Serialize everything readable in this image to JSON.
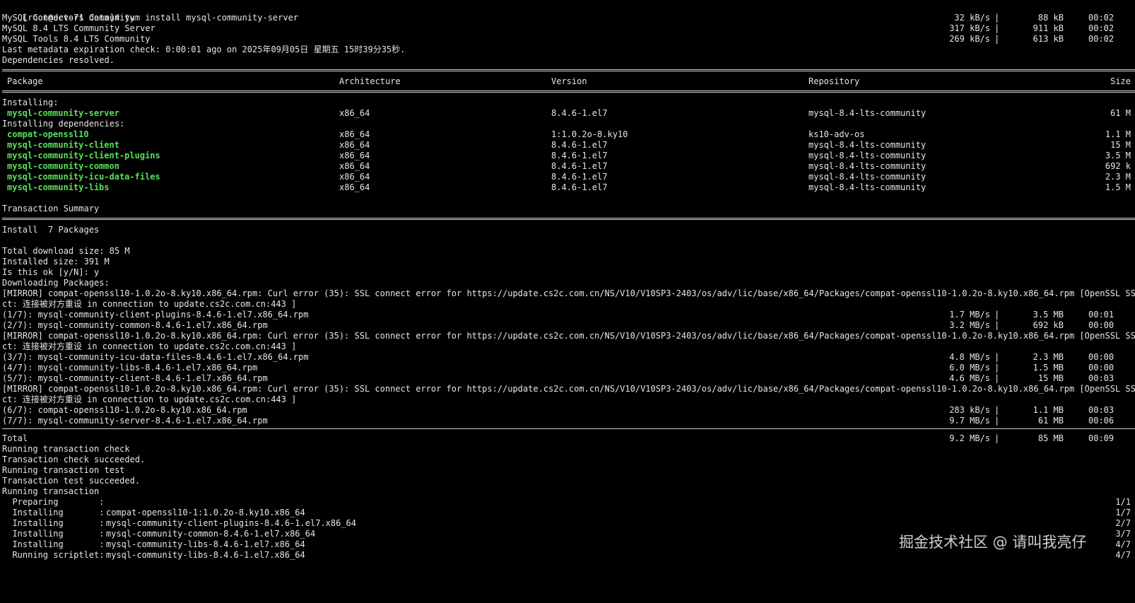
{
  "header": {
    "prompt": "[root@dev-71 data]#",
    "command": "yum install mysql-community-server"
  },
  "repos": [
    {
      "name": "MySQL Connectors Community",
      "speed": "32 kB/s",
      "size": "88 kB",
      "time": "00:02"
    },
    {
      "name": "MySQL 8.4 LTS Community Server",
      "speed": "317 kB/s",
      "size": "911 kB",
      "time": "00:02"
    },
    {
      "name": "MySQL Tools 8.4 LTS Community",
      "speed": "269 kB/s",
      "size": "613 kB",
      "time": "00:02"
    }
  ],
  "metadata_line": "Last metadata expiration check: 0:00:01 ago on 2025年09月05日 星期五 15时39分35秒.",
  "deps_resolved": "Dependencies resolved.",
  "table": {
    "headers": {
      "package": "Package",
      "arch": "Architecture",
      "version": "Version",
      "repo": "Repository",
      "size": "Size"
    },
    "installing_label": "Installing:",
    "installing": [
      {
        "package": "mysql-community-server",
        "arch": "x86_64",
        "version": "8.4.6-1.el7",
        "repo": "mysql-8.4-lts-community",
        "size": "61 M"
      }
    ],
    "deps_label": "Installing dependencies:",
    "deps": [
      {
        "package": "compat-openssl10",
        "arch": "x86_64",
        "version": "1:1.0.2o-8.ky10",
        "repo": "ks10-adv-os",
        "size": "1.1 M"
      },
      {
        "package": "mysql-community-client",
        "arch": "x86_64",
        "version": "8.4.6-1.el7",
        "repo": "mysql-8.4-lts-community",
        "size": "15 M"
      },
      {
        "package": "mysql-community-client-plugins",
        "arch": "x86_64",
        "version": "8.4.6-1.el7",
        "repo": "mysql-8.4-lts-community",
        "size": "3.5 M"
      },
      {
        "package": "mysql-community-common",
        "arch": "x86_64",
        "version": "8.4.6-1.el7",
        "repo": "mysql-8.4-lts-community",
        "size": "692 k"
      },
      {
        "package": "mysql-community-icu-data-files",
        "arch": "x86_64",
        "version": "8.4.6-1.el7",
        "repo": "mysql-8.4-lts-community",
        "size": "2.3 M"
      },
      {
        "package": "mysql-community-libs",
        "arch": "x86_64",
        "version": "8.4.6-1.el7",
        "repo": "mysql-8.4-lts-community",
        "size": "1.5 M"
      }
    ]
  },
  "summary": {
    "title": "Transaction Summary",
    "install": "Install  7 Packages",
    "total_download": "Total download size: 85 M",
    "installed_size": "Installed size: 391 M",
    "confirm": "Is this ok [y/N]: y",
    "downloading": "Downloading Packages:"
  },
  "mirror_error": {
    "part1": "[MIRROR] compat-openssl10-1.0.2o-8.ky10.x86_64.rpm: Curl error (35): SSL connect error for https://update.cs2c.com.cn/NS/V10/V10SP3-2403/os/adv/lic/base/x86_64/Packages/compat-openssl10-1.0.2o-8.ky10.x86_64.rpm [OpenSSL SSL_conne",
    "part2": "ct: 连接被对方重设 in connection to update.cs2c.com.cn:443 ]"
  },
  "downloads": [
    {
      "name": "(1/7): mysql-community-client-plugins-8.4.6-1.el7.x86_64.rpm",
      "speed": "1.7 MB/s",
      "size": "3.5 MB",
      "time": "00:01"
    },
    {
      "name": "(2/7): mysql-community-common-8.4.6-1.el7.x86_64.rpm",
      "speed": "3.2 MB/s",
      "size": "692 kB",
      "time": "00:00"
    },
    {
      "name": "(3/7): mysql-community-icu-data-files-8.4.6-1.el7.x86_64.rpm",
      "speed": "4.8 MB/s",
      "size": "2.3 MB",
      "time": "00:00"
    },
    {
      "name": "(4/7): mysql-community-libs-8.4.6-1.el7.x86_64.rpm",
      "speed": "6.0 MB/s",
      "size": "1.5 MB",
      "time": "00:00"
    },
    {
      "name": "(5/7): mysql-community-client-8.4.6-1.el7.x86_64.rpm",
      "speed": "4.6 MB/s",
      "size": "15 MB",
      "time": "00:03"
    },
    {
      "name": "(6/7): compat-openssl10-1.0.2o-8.ky10.x86_64.rpm",
      "speed": "283 kB/s",
      "size": "1.1 MB",
      "time": "00:03"
    },
    {
      "name": "(7/7): mysql-community-server-8.4.6-1.el7.x86_64.rpm",
      "speed": "9.7 MB/s",
      "size": "61 MB",
      "time": "00:06"
    }
  ],
  "total": {
    "label": "Total",
    "speed": "9.2 MB/s",
    "size": "85 MB",
    "time": "00:09"
  },
  "transaction": {
    "check": "Running transaction check",
    "check_ok": "Transaction check succeeded.",
    "test": "Running transaction test",
    "test_ok": "Transaction test succeeded.",
    "running": "Running transaction"
  },
  "steps": [
    {
      "action": "  Preparing        :",
      "pkg": "",
      "count": "1/1"
    },
    {
      "action": "  Installing       :",
      "pkg": "compat-openssl10-1:1.0.2o-8.ky10.x86_64",
      "count": "1/7"
    },
    {
      "action": "  Installing       :",
      "pkg": "mysql-community-client-plugins-8.4.6-1.el7.x86_64",
      "count": "2/7"
    },
    {
      "action": "  Installing       :",
      "pkg": "mysql-community-common-8.4.6-1.el7.x86_64",
      "count": "3/7"
    },
    {
      "action": "  Installing       :",
      "pkg": "mysql-community-libs-8.4.6-1.el7.x86_64",
      "count": "4/7"
    },
    {
      "action": "  Running scriptlet:",
      "pkg": "mysql-community-libs-8.4.6-1.el7.x86_64",
      "count": "4/7"
    }
  ],
  "watermark": "掘金技术社区 @ 请叫我亮仔"
}
